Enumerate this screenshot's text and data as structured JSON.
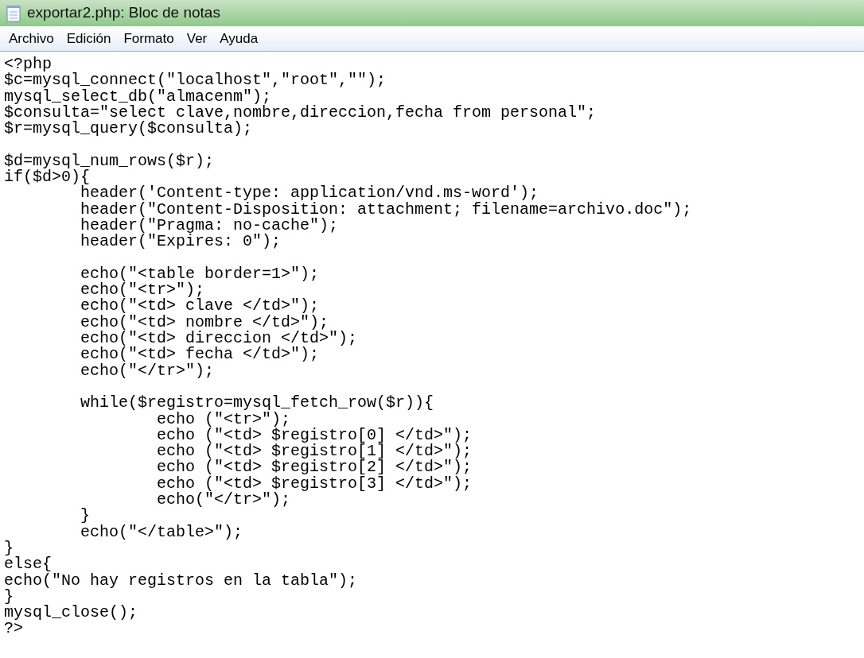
{
  "window": {
    "title": "exportar2.php: Bloc de notas"
  },
  "menu": [
    {
      "label": "Archivo"
    },
    {
      "label": "Edición"
    },
    {
      "label": "Formato"
    },
    {
      "label": "Ver"
    },
    {
      "label": "Ayuda"
    }
  ],
  "editor": {
    "blocks": [
      [
        "<?php",
        "$c=mysql_connect(\"localhost\",\"root\",\"\");",
        "mysql_select_db(\"almacenm\");",
        "$consulta=\"select clave,nombre,direccion,fecha from personal\";",
        "$r=mysql_query($consulta);"
      ],
      [
        "$d=mysql_num_rows($r);",
        "if($d>0){",
        "        header('Content-type: application/vnd.ms-word');",
        "        header(\"Content-Disposition: attachment; filename=archivo.doc\");",
        "        header(\"Pragma: no-cache\");",
        "        header(\"Expires: 0\");"
      ],
      [
        "        echo(\"<table border=1>\");",
        "        echo(\"<tr>\");",
        "        echo(\"<td> clave </td>\");",
        "        echo(\"<td> nombre </td>\");",
        "        echo(\"<td> direccion </td>\");",
        "        echo(\"<td> fecha </td>\");",
        "        echo(\"</tr>\");"
      ],
      [
        "        while($registro=mysql_fetch_row($r)){",
        "                echo (\"<tr>\");",
        "                echo (\"<td> $registro[0] </td>\");",
        "                echo (\"<td> $registro[1] </td>\");",
        "                echo (\"<td> $registro[2] </td>\");",
        "                echo (\"<td> $registro[3] </td>\");",
        "                echo(\"</tr>\");",
        "        }",
        "        echo(\"</table>\");",
        "}",
        "else{",
        "echo(\"No hay registros en la tabla\");",
        "}",
        "mysql_close();",
        "?>"
      ]
    ]
  }
}
